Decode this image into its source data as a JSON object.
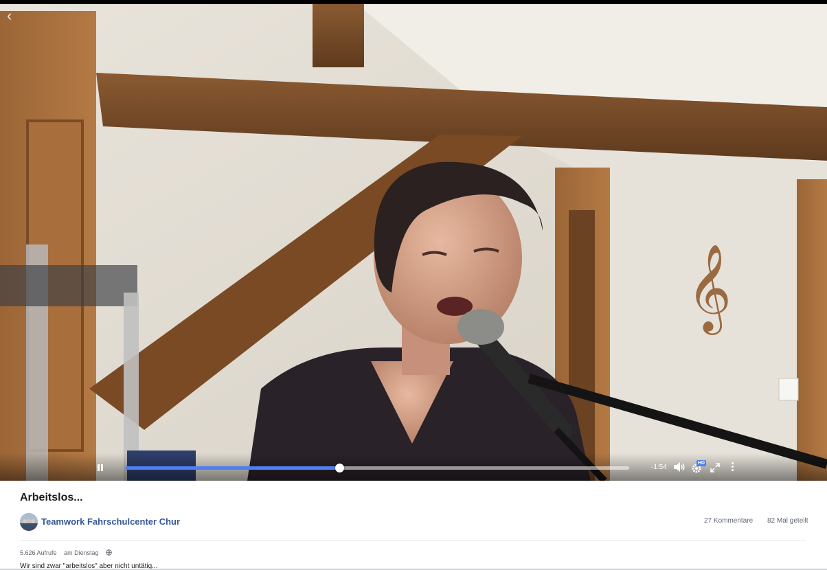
{
  "video": {
    "back_icon": "chevron-left-icon",
    "progress": 0.425,
    "time_remaining": "-1:54",
    "hd_label": "HD",
    "icons": [
      "pause-icon",
      "volume-icon",
      "settings-gear-icon",
      "fullscreen-icon",
      "more-vertical-icon"
    ]
  },
  "post": {
    "title": "Arbeitslos...",
    "page_name": "Teamwork Fahrschulcenter Chur",
    "comments": "27 Kommentare",
    "shares": "82 Mal geteilt",
    "views": "5.626 Aufrufe",
    "date": "am Dienstag",
    "privacy_icon": "globe-icon",
    "description": "Wir sind zwar \"arbeitslos\" aber nicht untätig..."
  },
  "colors": {
    "accent": "#4f7ff0",
    "link": "#365899",
    "muted_text": "#606770"
  }
}
